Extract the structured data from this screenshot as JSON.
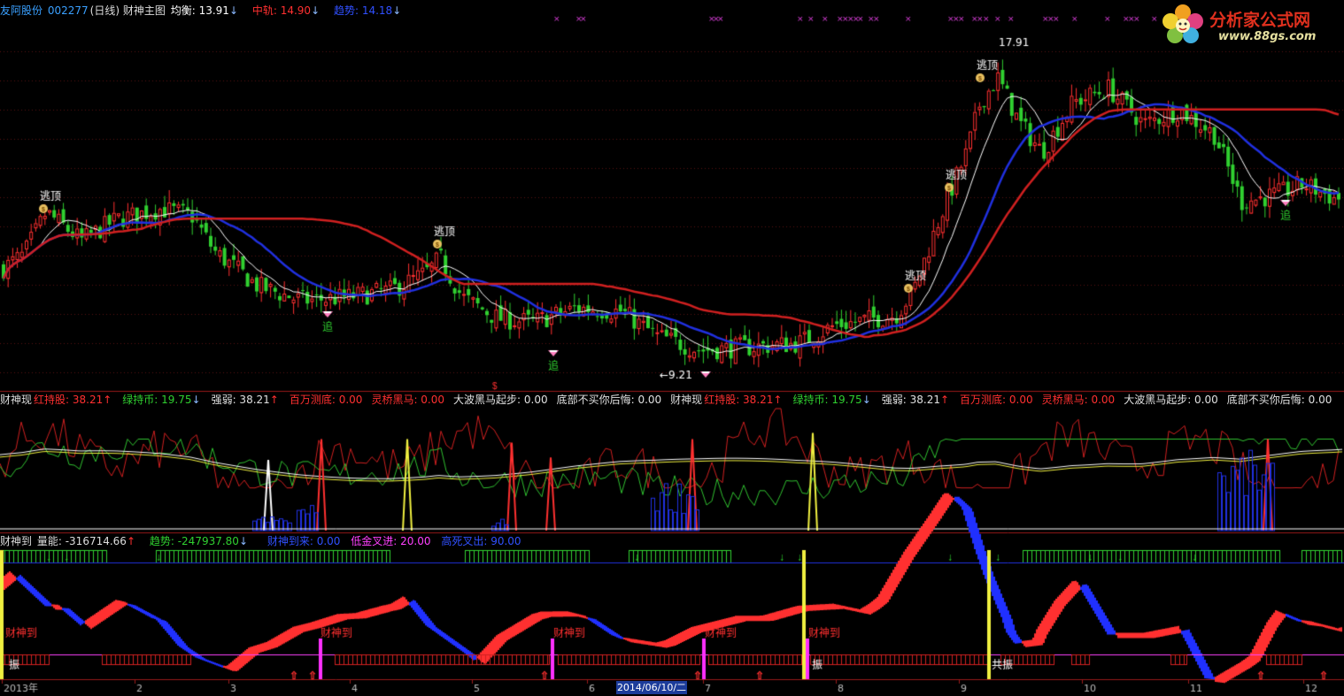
{
  "header_main": {
    "stock": "友阿股份",
    "code": "002277",
    "period": "(日线)",
    "indicator": "财神主图",
    "avg_label": "均衡:",
    "avg_value": "13.91",
    "mid_label": "中轨:",
    "mid_value": "14.90",
    "trend_label": "趋势:",
    "trend_value": "14.18",
    "arrow_down": "↓",
    "arrow_up": "↑"
  },
  "header_mid": {
    "name": "财神现",
    "items": [
      {
        "label": "红持股:",
        "value": "38.21",
        "arrow": "↑",
        "color": "#ff3030"
      },
      {
        "label": "绿持币:",
        "value": "19.75",
        "arrow": "↓",
        "color": "#30d030"
      },
      {
        "label": "强弱:",
        "value": "38.21",
        "arrow": "↑",
        "color": "#e0e0e0"
      },
      {
        "label": "百万测底:",
        "value": "0.00",
        "arrow": "",
        "color": "#ff3030"
      },
      {
        "label": "灵桥黑马:",
        "value": "0.00",
        "arrow": "",
        "color": "#ff3030"
      },
      {
        "label": "大波黑马起步:",
        "value": "0.00",
        "arrow": "",
        "color": "#e0e0e0"
      },
      {
        "label": "底部不买你后悔:",
        "value": "0.00",
        "arrow": "",
        "color": "#e0e0e0"
      }
    ]
  },
  "header_bottom": {
    "name": "财神到",
    "energy_label": "量能:",
    "energy_value": "-316714.66",
    "trend_label": "趋势:",
    "trend_value": "-247937.80",
    "arrow_up": "↑",
    "arrow_down": "↓",
    "arrive_label": "财神到来:",
    "arrive_value": "0.00",
    "gold_label": "低金叉进:",
    "gold_value": "20.00",
    "death_label": "高死叉出:",
    "death_value": "90.00"
  },
  "logo": {
    "title": "分析家公式网",
    "url": "www.88gs.com"
  },
  "current_date": "2014/06/10/二",
  "colors": {
    "up": "#ff3030",
    "down": "#30d030",
    "balance": "#ffffff",
    "mid": "#d02020",
    "trend": "#2030e0"
  },
  "chart_data": {
    "type": "candlestick",
    "ylim": [
      8.5,
      18.5
    ],
    "peak_high": "17.91",
    "low_label": "9.21",
    "signals": {
      "escape": "逃顶",
      "chase": "追",
      "arrive": "财神到",
      "resonance": "振",
      "co_resonance": "共振"
    },
    "x_ticks": [
      "2013年",
      "2",
      "3",
      "4",
      "5",
      "6",
      "7",
      "8",
      "9",
      "10",
      "11",
      "12"
    ],
    "close_profile": [
      {
        "x": 0,
        "y": 11.9
      },
      {
        "x": 25,
        "y": 12.3
      },
      {
        "x": 50,
        "y": 13.5
      },
      {
        "x": 90,
        "y": 12.7
      },
      {
        "x": 130,
        "y": 13.3
      },
      {
        "x": 180,
        "y": 13.6
      },
      {
        "x": 215,
        "y": 13.4
      },
      {
        "x": 240,
        "y": 12.4
      },
      {
        "x": 290,
        "y": 11.4
      },
      {
        "x": 340,
        "y": 11.0
      },
      {
        "x": 390,
        "y": 11.1
      },
      {
        "x": 440,
        "y": 11.3
      },
      {
        "x": 480,
        "y": 11.8
      },
      {
        "x": 495,
        "y": 12.2
      },
      {
        "x": 520,
        "y": 11.1
      },
      {
        "x": 560,
        "y": 10.5
      },
      {
        "x": 600,
        "y": 10.4
      },
      {
        "x": 650,
        "y": 10.8
      },
      {
        "x": 700,
        "y": 10.7
      },
      {
        "x": 740,
        "y": 10.0
      },
      {
        "x": 790,
        "y": 9.6
      },
      {
        "x": 850,
        "y": 9.7
      },
      {
        "x": 900,
        "y": 9.8
      },
      {
        "x": 940,
        "y": 10.3
      },
      {
        "x": 1010,
        "y": 10.6
      },
      {
        "x": 1030,
        "y": 11.3
      },
      {
        "x": 1060,
        "y": 13.4
      },
      {
        "x": 1090,
        "y": 15.2
      },
      {
        "x": 1105,
        "y": 16.6
      },
      {
        "x": 1125,
        "y": 17.3
      },
      {
        "x": 1150,
        "y": 16.0
      },
      {
        "x": 1175,
        "y": 15.2
      },
      {
        "x": 1210,
        "y": 16.6
      },
      {
        "x": 1250,
        "y": 17.0
      },
      {
        "x": 1290,
        "y": 16.0
      },
      {
        "x": 1330,
        "y": 16.4
      },
      {
        "x": 1370,
        "y": 15.7
      },
      {
        "x": 1400,
        "y": 13.8
      },
      {
        "x": 1440,
        "y": 14.0
      },
      {
        "x": 1470,
        "y": 14.3
      },
      {
        "x": 1505,
        "y": 13.9
      }
    ]
  }
}
